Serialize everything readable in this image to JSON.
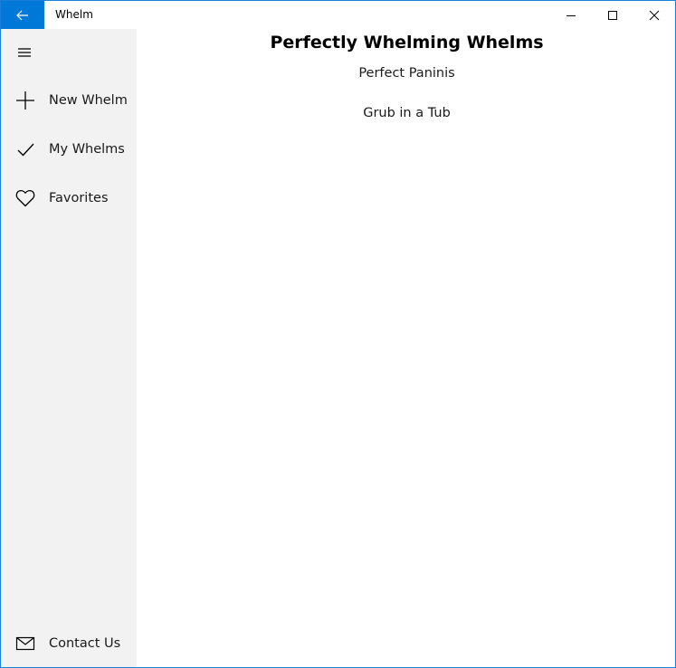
{
  "titlebar": {
    "app_title": "Whelm",
    "back_icon": "arrow-left-icon",
    "minimize_icon": "minimize-icon",
    "maximize_icon": "maximize-icon",
    "close_icon": "close-icon",
    "accent_color": "#0078d7"
  },
  "sidebar": {
    "menu_icon": "hamburger-menu-icon",
    "background_color": "#f2f2f2",
    "items": [
      {
        "label": "New Whelm",
        "icon": "plus-icon"
      },
      {
        "label": "My Whelms",
        "icon": "checkmark-icon"
      },
      {
        "label": "Favorites",
        "icon": "heart-icon"
      }
    ],
    "footer_item": {
      "label": "Contact Us",
      "icon": "mail-icon"
    }
  },
  "main": {
    "title": "Perfectly Whelming Whelms",
    "whelms": [
      "Perfect Paninis",
      "Grub in a Tub"
    ]
  }
}
